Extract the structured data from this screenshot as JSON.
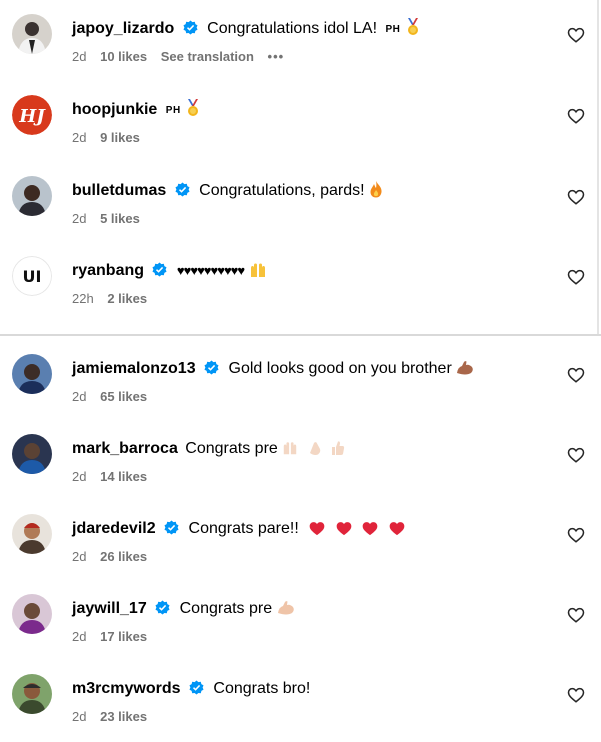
{
  "comments": [
    {
      "username": "japoy_lizardo",
      "verified": true,
      "text": "Congratulations idol LA!",
      "flag": "PH",
      "emoji": "medal",
      "age": "2d",
      "likes": "10 likes",
      "extra": "See translation",
      "more": "•••"
    },
    {
      "username": "hoopjunkie",
      "verified": false,
      "text": "",
      "flag": "PH",
      "emoji": "medal",
      "age": "2d",
      "likes": "9 likes"
    },
    {
      "username": "bulletdumas",
      "verified": true,
      "text": "Congratulations, pards!",
      "emoji": "fire",
      "age": "2d",
      "likes": "5 likes"
    },
    {
      "username": "ryanbang",
      "verified": true,
      "text": "♥♥♥♥♥♥♥♥♥♥",
      "emoji": "raised-hands",
      "age": "22h",
      "likes": "2 likes"
    },
    {
      "username": "jamiemalonzo13",
      "verified": true,
      "text": "Gold looks good on you brother",
      "emoji": "flexed-biceps",
      "age": "2d",
      "likes": "65 likes"
    },
    {
      "username": "mark_barroca",
      "verified": false,
      "text": "Congrats pre",
      "emoji": "raised-hands clapping thumbs-up",
      "age": "2d",
      "likes": "14 likes"
    },
    {
      "username": "jdaredevil2",
      "verified": true,
      "text": "Congrats pare!!",
      "emoji": "red-hearts",
      "age": "2d",
      "likes": "26 likes"
    },
    {
      "username": "jaywill_17",
      "verified": true,
      "text": "Congrats pre",
      "emoji": "flexed-biceps",
      "age": "2d",
      "likes": "17 likes"
    },
    {
      "username": "m3rcmywords",
      "verified": true,
      "text": "Congrats bro!",
      "age": "2d",
      "likes": "23 likes"
    }
  ],
  "colors": {
    "verified": "#0095f6",
    "meta": "#737373",
    "heart_emoji": "#e0243a",
    "hoopjunkie_logo": "#d8391c"
  },
  "icons": {
    "verified": "verified-badge-icon",
    "like": "heart-outline-icon"
  }
}
